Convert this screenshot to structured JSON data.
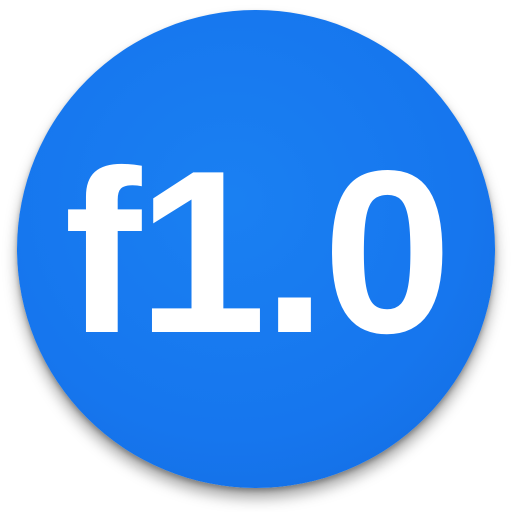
{
  "app_icon": {
    "label": "f1.0",
    "background_color": "#1676ee",
    "text_color": "#ffffff"
  }
}
